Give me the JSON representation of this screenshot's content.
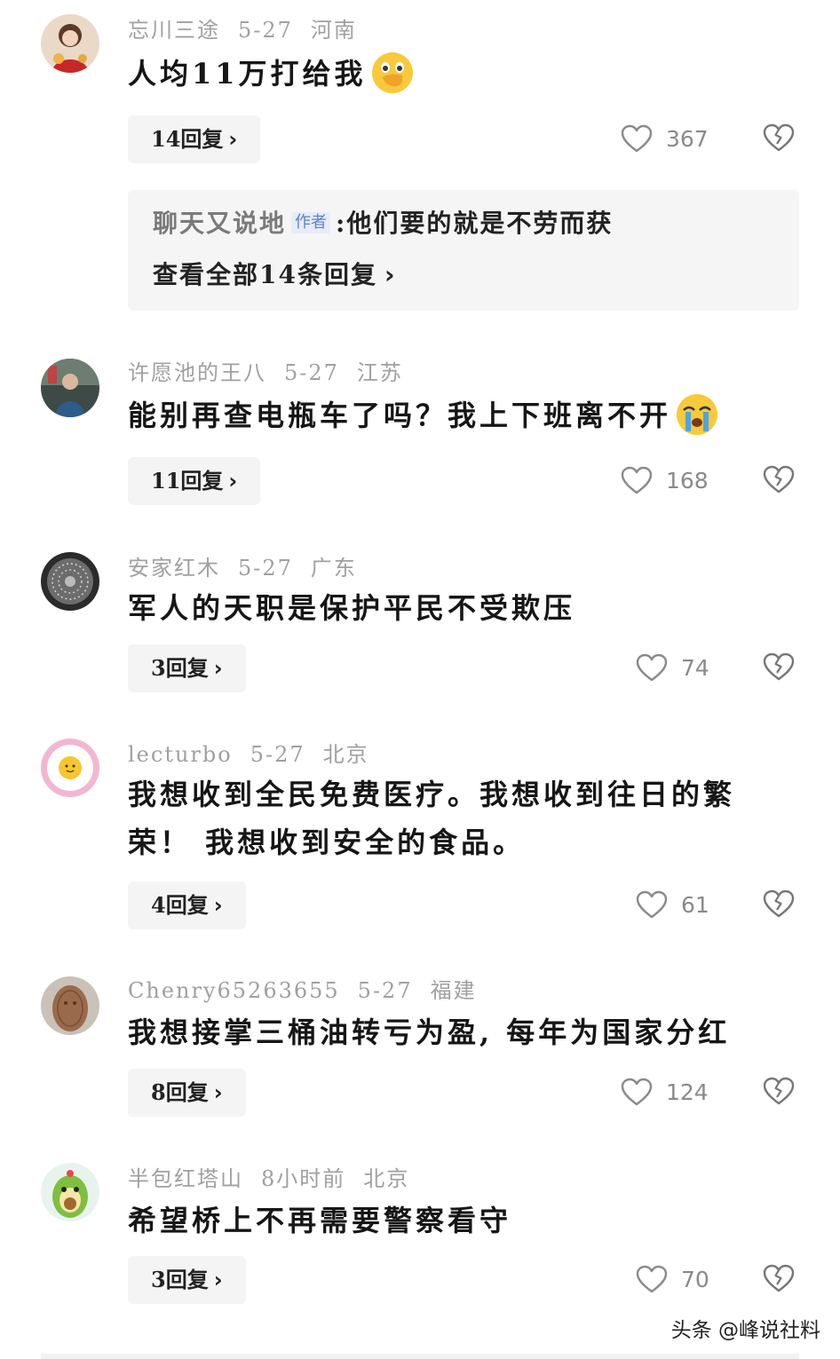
{
  "comments": [
    {
      "user": "忘川三途",
      "date": "5-27",
      "location": "河南",
      "text": "人均11万打给我",
      "emoji": "hand-over-mouth-emoji",
      "reply_label": "14回复",
      "likes": "367",
      "subreply": {
        "author": "聊天又说地",
        "author_tag": "作者",
        "text": "他们要的就是不劳而获",
        "view_all": "查看全部14条回复"
      }
    },
    {
      "user": "许愿池的王八",
      "date": "5-27",
      "location": "江苏",
      "text": "能别再查电瓶车了吗？我上下班离不开",
      "emoji": "crying-face-emoji",
      "reply_label": "11回复",
      "likes": "168"
    },
    {
      "user": "安家红木",
      "date": "5-27",
      "location": "广东",
      "text": "军人的天职是保护平民不受欺压",
      "reply_label": "3回复",
      "likes": "74"
    },
    {
      "user": "lecturbo",
      "date": "5-27",
      "location": "北京",
      "text_line1": "我想收到全民免费医疗。我想收到往日的繁",
      "text_line2": "荣！ 我想收到安全的食品。",
      "reply_label": "4回复",
      "likes": "61"
    },
    {
      "user": "Chenry65263655",
      "date": "5-27",
      "location": "福建",
      "text": "我想接掌三桶油转亏为盈, 每年为国家分红",
      "reply_label": "8回复",
      "likes": "124"
    },
    {
      "user": "半包红塔山",
      "date": "8小时前",
      "location": "北京",
      "text": "希望桥上不再需要警察看守",
      "reply_label": "3回复",
      "likes": "70"
    }
  ],
  "chevron": "›",
  "watermark": "头条 @峰说社料",
  "colors": {
    "meta": "#a0a0a0",
    "button_bg": "#f4f4f4",
    "author_tag_bg": "#e6edf9",
    "author_tag_fg": "#5a82c8"
  }
}
